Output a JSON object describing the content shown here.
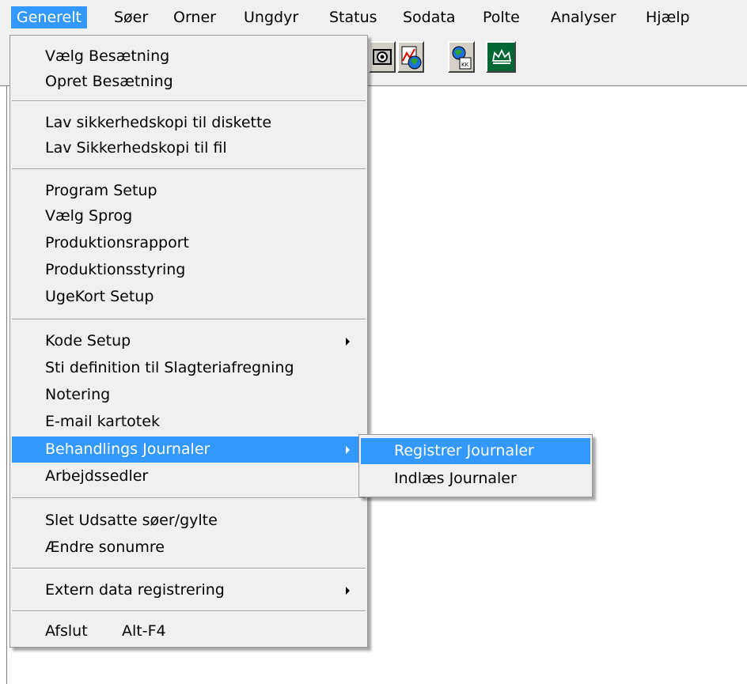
{
  "menubar": {
    "items": [
      "Generelt",
      "Søer",
      "Orner",
      "Ungdyr",
      "Status",
      "Sodata",
      "Polte",
      "Analyser",
      "Hjælp"
    ],
    "active": "Generelt"
  },
  "toolbar": {
    "icons": [
      "camera-icon",
      "chart-globe-icon",
      "user-globe-icon",
      "crown-icon"
    ]
  },
  "generelt_menu": {
    "items": [
      {
        "label": "Vælg Besætning"
      },
      {
        "label": "Opret Besætning"
      },
      {
        "label": "Lav sikkerhedskopi til diskette"
      },
      {
        "label": "Lav Sikkerhedskopi til fil"
      },
      {
        "label": "Program Setup"
      },
      {
        "label": "Vælg Sprog"
      },
      {
        "label": "Produktionsrapport"
      },
      {
        "label": "Produktionsstyring"
      },
      {
        "label": "UgeKort Setup"
      },
      {
        "label": "Kode Setup"
      },
      {
        "label": "Sti definition til Slagteriafregning"
      },
      {
        "label": "Notering"
      },
      {
        "label": "E-mail kartotek"
      },
      {
        "label": "Behandlings Journaler"
      },
      {
        "label": "Arbejdssedler"
      },
      {
        "label": "Slet Udsatte søer/gylte"
      },
      {
        "label": "Ændre sonumre"
      },
      {
        "label": "Extern data registrering"
      },
      {
        "label": "Afslut",
        "shortcut": "Alt-F4"
      }
    ]
  },
  "journal_submenu": {
    "items": [
      {
        "label": "Registrer Journaler"
      },
      {
        "label": "Indlæs Journaler"
      }
    ]
  },
  "colors": {
    "highlight": "#3399ff",
    "menu_bg": "#f0f0f0",
    "crown_button": "#006633"
  }
}
